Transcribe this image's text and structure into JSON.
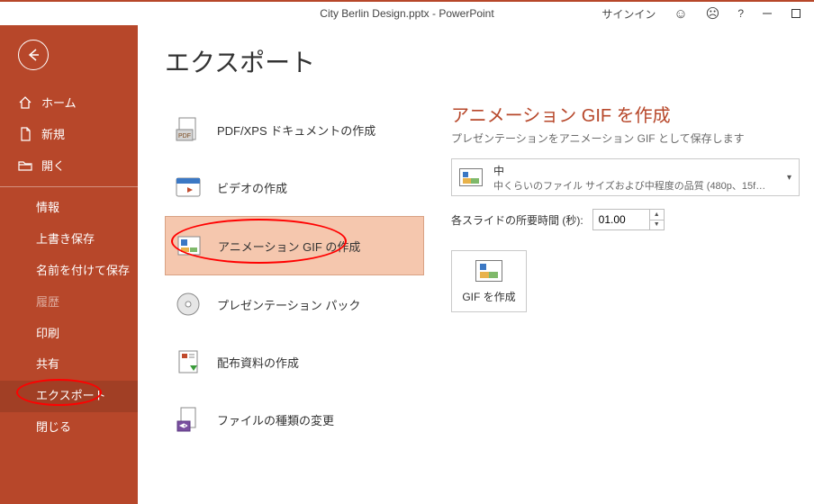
{
  "titlebar": {
    "title": "City Berlin Design.pptx  -  PowerPoint",
    "signin": "サインイン",
    "help": "?"
  },
  "sidebar": {
    "home": "ホーム",
    "new": "新規",
    "open": "開く",
    "info": "情報",
    "save_overwrite": "上書き保存",
    "save_as": "名前を付けて保存",
    "history": "履歴",
    "print": "印刷",
    "share": "共有",
    "export": "エクスポート",
    "close": "閉じる"
  },
  "main": {
    "heading": "エクスポート",
    "options": {
      "pdf_xps": "PDF/XPS ドキュメントの作成",
      "video": "ビデオの作成",
      "gif": "アニメーション GIF の作成",
      "package": "プレゼンテーション パック",
      "handouts": "配布資料の作成",
      "filetype": "ファイルの種類の変更"
    },
    "detail": {
      "title": "アニメーション GIF を作成",
      "subtitle": "プレゼンテーションをアニメーション GIF として保存します",
      "quality_line1": "中",
      "quality_line2": "中くらいのファイル サイズおよび中程度の品質 (480p、15f…",
      "duration_label": "各スライドの所要時間 (秒):",
      "duration_value": "01.00",
      "create_label": "GIF を作成"
    }
  }
}
